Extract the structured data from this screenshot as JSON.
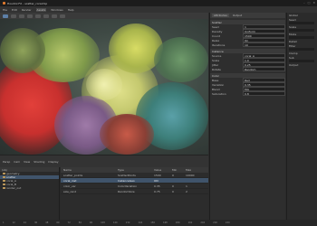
{
  "window": {
    "title": "Houdini FX - scatter_coral.hip"
  },
  "menubar": {
    "items": [
      "File",
      "Edit",
      "Render",
      "Assets",
      "Windows",
      "Help"
    ],
    "highlighted": 3
  },
  "viewport_toolbar": {
    "items": [
      "Persp",
      "Cam",
      "View",
      "Shading",
      "Display"
    ]
  },
  "tree": {
    "header": "/obj",
    "items": [
      "geometry",
      "scatter",
      "coral_A",
      "coral_B",
      "render_out"
    ],
    "selected": 1
  },
  "table": {
    "columns": [
      "Name",
      "Type",
      "Value",
      "Min",
      "Max"
    ],
    "rows": [
      [
        "scatter_points",
        "ScatterPoints",
        "1500",
        "0",
        "10000"
      ],
      [
        "coral_inst",
        "InstanceGeo",
        "ON",
        "",
        ""
      ],
      [
        "color_var",
        "ColorVariation",
        "0.35",
        "0",
        "1"
      ],
      [
        "size_rand",
        "RandomSize",
        "0.75",
        "0",
        "2"
      ]
    ],
    "selected": 1
  },
  "timeline": {
    "ticks": [
      "1",
      "12",
      "24",
      "36",
      "48",
      "60",
      "72",
      "84",
      "96",
      "108",
      "120",
      "132",
      "144",
      "156",
      "168",
      "180",
      "192",
      "204",
      "216",
      "240"
    ]
  },
  "attr": {
    "tabs": [
      "Attributes",
      "Output"
    ],
    "sections": [
      {
        "title": "Scatter",
        "rows": [
          [
            "Seed",
            "1"
          ],
          [
            "Density",
            "Uniform"
          ],
          [
            "Count",
            "1500"
          ],
          [
            "Relax",
            "On"
          ],
          [
            "Iterations",
            "10"
          ]
        ]
      },
      {
        "title": "Instance",
        "rows": [
          [
            "Source",
            "coral_A"
          ],
          [
            "Scale",
            "1.0"
          ],
          [
            "Jitter",
            "0.25"
          ],
          [
            "Rotate",
            "Random"
          ]
        ]
      },
      {
        "title": "Color",
        "rows": [
          [
            "Base",
            "Red"
          ],
          [
            "Variation",
            "0.35"
          ],
          [
            "Blend",
            "Mix"
          ],
          [
            "Saturation",
            "0.8"
          ]
        ]
      }
    ]
  },
  "props": {
    "items": [
      "Global",
      "Seed",
      "Scale",
      "Mode",
      "Detail",
      "Filter",
      "Clamp",
      "Sub",
      "Output"
    ]
  },
  "colors": {
    "accent": "#5d7fa6",
    "selection": "#40546b"
  }
}
